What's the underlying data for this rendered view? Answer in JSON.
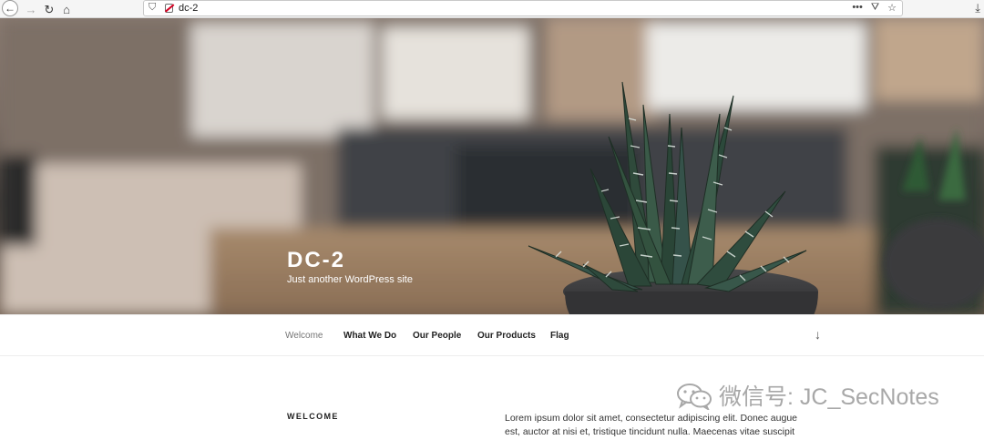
{
  "browser": {
    "url": "dc-2",
    "icons": {
      "back": "back-arrow-icon",
      "forward": "forward-arrow-icon",
      "reload": "reload-icon",
      "home": "home-icon",
      "tracking": "shield-icon",
      "insecure": "insecure-lock-icon",
      "more": "more-icon",
      "pocket": "pocket-icon",
      "bookmark": "star-icon",
      "downloads": "download-icon"
    }
  },
  "site": {
    "title": "DC-2",
    "description": "Just another WordPress site"
  },
  "nav": {
    "items": [
      {
        "label": "Welcome",
        "current": true
      },
      {
        "label": "What We Do",
        "current": false
      },
      {
        "label": "Our People",
        "current": false
      },
      {
        "label": "Our Products",
        "current": false
      },
      {
        "label": "Flag",
        "current": false
      }
    ],
    "scroll_icon": "down-arrow-icon"
  },
  "content": {
    "heading": "WELCOME",
    "body": "Lorem ipsum dolor sit amet, consectetur adipiscing elit. Donec augue est, auctor at nisi et, tristique tincidunt nulla. Maecenas vitae suscipit"
  },
  "watermark": {
    "text": "微信号: JC_SecNotes"
  },
  "colors": {
    "text_dark": "#222222",
    "nav_current": "#767676",
    "title_white": "#ffffff",
    "watermark_gray": "#a8a8a8"
  }
}
